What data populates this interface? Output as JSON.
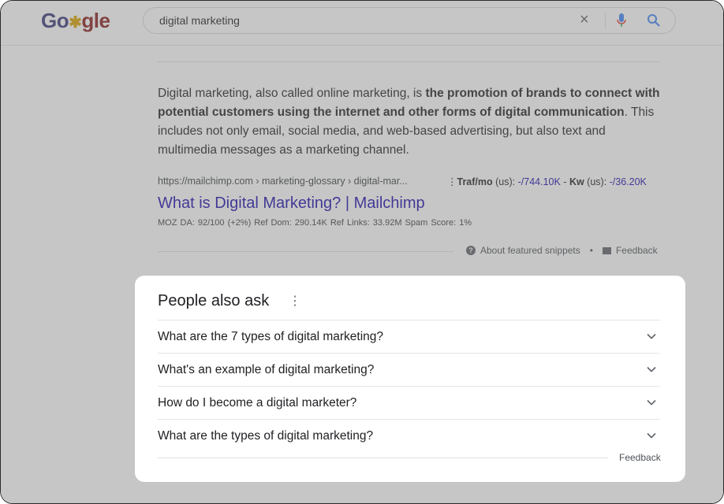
{
  "header": {
    "logo_parts": [
      "Go",
      "gle"
    ],
    "query": "digital marketing"
  },
  "snippet": {
    "text_pre": "Digital marketing, also called online marketing, is ",
    "text_bold": "the promotion of brands to connect with potential customers using the internet and other forms of digital communication",
    "text_post": ". This includes not only email, social media, and web-based advertising, but also text and multimedia messages as a marketing channel.",
    "cite": "https://mailchimp.com › marketing-glossary › digital-mar...",
    "traf_label": "Traf/mo",
    "traf_region": " (us): ",
    "traf_value": "-/744.10K",
    "kw_sep": " - ",
    "kw_label": "Kw",
    "kw_region": " (us): ",
    "kw_value": "-/36.20K",
    "title": "What is Digital Marketing? | Mailchimp",
    "moz": "MOZ DA: 92/100 (+2%)   Ref Dom: 290.14K   Ref Links: 33.92M   Spam Score: 1%",
    "about": "About featured snippets",
    "dot": "•",
    "feedback": "Feedback"
  },
  "paa": {
    "title": "People also ask",
    "questions": [
      "What are the 7 types of digital marketing?",
      "What's an example of digital marketing?",
      "How do I become a digital marketer?",
      "What are the types of digital marketing?"
    ],
    "feedback": "Feedback"
  },
  "colors": {
    "link": "#1a0dab",
    "text": "#202124",
    "overlay": "rgba(120,120,120,0.42)"
  },
  "icons": [
    "close-icon",
    "mic-icon",
    "search-icon",
    "more-vert-icon",
    "chevron-down-icon",
    "help-icon",
    "feedback-icon"
  ]
}
